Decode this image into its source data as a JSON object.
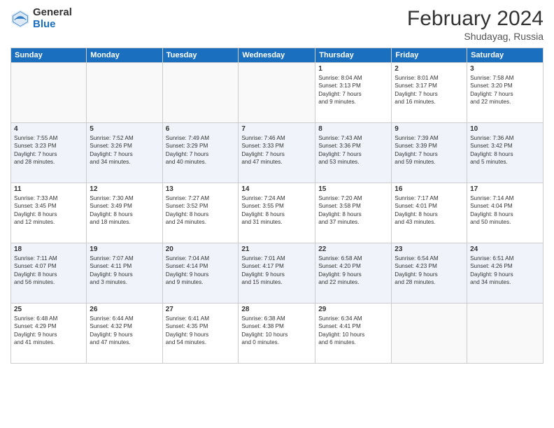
{
  "header": {
    "logo_general": "General",
    "logo_blue": "Blue",
    "title": "February 2024",
    "location": "Shudayag, Russia"
  },
  "days_of_week": [
    "Sunday",
    "Monday",
    "Tuesday",
    "Wednesday",
    "Thursday",
    "Friday",
    "Saturday"
  ],
  "weeks": [
    [
      {
        "day": "",
        "info": ""
      },
      {
        "day": "",
        "info": ""
      },
      {
        "day": "",
        "info": ""
      },
      {
        "day": "",
        "info": ""
      },
      {
        "day": "1",
        "info": "Sunrise: 8:04 AM\nSunset: 3:13 PM\nDaylight: 7 hours\nand 9 minutes."
      },
      {
        "day": "2",
        "info": "Sunrise: 8:01 AM\nSunset: 3:17 PM\nDaylight: 7 hours\nand 16 minutes."
      },
      {
        "day": "3",
        "info": "Sunrise: 7:58 AM\nSunset: 3:20 PM\nDaylight: 7 hours\nand 22 minutes."
      }
    ],
    [
      {
        "day": "4",
        "info": "Sunrise: 7:55 AM\nSunset: 3:23 PM\nDaylight: 7 hours\nand 28 minutes."
      },
      {
        "day": "5",
        "info": "Sunrise: 7:52 AM\nSunset: 3:26 PM\nDaylight: 7 hours\nand 34 minutes."
      },
      {
        "day": "6",
        "info": "Sunrise: 7:49 AM\nSunset: 3:29 PM\nDaylight: 7 hours\nand 40 minutes."
      },
      {
        "day": "7",
        "info": "Sunrise: 7:46 AM\nSunset: 3:33 PM\nDaylight: 7 hours\nand 47 minutes."
      },
      {
        "day": "8",
        "info": "Sunrise: 7:43 AM\nSunset: 3:36 PM\nDaylight: 7 hours\nand 53 minutes."
      },
      {
        "day": "9",
        "info": "Sunrise: 7:39 AM\nSunset: 3:39 PM\nDaylight: 7 hours\nand 59 minutes."
      },
      {
        "day": "10",
        "info": "Sunrise: 7:36 AM\nSunset: 3:42 PM\nDaylight: 8 hours\nand 5 minutes."
      }
    ],
    [
      {
        "day": "11",
        "info": "Sunrise: 7:33 AM\nSunset: 3:45 PM\nDaylight: 8 hours\nand 12 minutes."
      },
      {
        "day": "12",
        "info": "Sunrise: 7:30 AM\nSunset: 3:49 PM\nDaylight: 8 hours\nand 18 minutes."
      },
      {
        "day": "13",
        "info": "Sunrise: 7:27 AM\nSunset: 3:52 PM\nDaylight: 8 hours\nand 24 minutes."
      },
      {
        "day": "14",
        "info": "Sunrise: 7:24 AM\nSunset: 3:55 PM\nDaylight: 8 hours\nand 31 minutes."
      },
      {
        "day": "15",
        "info": "Sunrise: 7:20 AM\nSunset: 3:58 PM\nDaylight: 8 hours\nand 37 minutes."
      },
      {
        "day": "16",
        "info": "Sunrise: 7:17 AM\nSunset: 4:01 PM\nDaylight: 8 hours\nand 43 minutes."
      },
      {
        "day": "17",
        "info": "Sunrise: 7:14 AM\nSunset: 4:04 PM\nDaylight: 8 hours\nand 50 minutes."
      }
    ],
    [
      {
        "day": "18",
        "info": "Sunrise: 7:11 AM\nSunset: 4:07 PM\nDaylight: 8 hours\nand 56 minutes."
      },
      {
        "day": "19",
        "info": "Sunrise: 7:07 AM\nSunset: 4:11 PM\nDaylight: 9 hours\nand 3 minutes."
      },
      {
        "day": "20",
        "info": "Sunrise: 7:04 AM\nSunset: 4:14 PM\nDaylight: 9 hours\nand 9 minutes."
      },
      {
        "day": "21",
        "info": "Sunrise: 7:01 AM\nSunset: 4:17 PM\nDaylight: 9 hours\nand 15 minutes."
      },
      {
        "day": "22",
        "info": "Sunrise: 6:58 AM\nSunset: 4:20 PM\nDaylight: 9 hours\nand 22 minutes."
      },
      {
        "day": "23",
        "info": "Sunrise: 6:54 AM\nSunset: 4:23 PM\nDaylight: 9 hours\nand 28 minutes."
      },
      {
        "day": "24",
        "info": "Sunrise: 6:51 AM\nSunset: 4:26 PM\nDaylight: 9 hours\nand 34 minutes."
      }
    ],
    [
      {
        "day": "25",
        "info": "Sunrise: 6:48 AM\nSunset: 4:29 PM\nDaylight: 9 hours\nand 41 minutes."
      },
      {
        "day": "26",
        "info": "Sunrise: 6:44 AM\nSunset: 4:32 PM\nDaylight: 9 hours\nand 47 minutes."
      },
      {
        "day": "27",
        "info": "Sunrise: 6:41 AM\nSunset: 4:35 PM\nDaylight: 9 hours\nand 54 minutes."
      },
      {
        "day": "28",
        "info": "Sunrise: 6:38 AM\nSunset: 4:38 PM\nDaylight: 10 hours\nand 0 minutes."
      },
      {
        "day": "29",
        "info": "Sunrise: 6:34 AM\nSunset: 4:41 PM\nDaylight: 10 hours\nand 6 minutes."
      },
      {
        "day": "",
        "info": ""
      },
      {
        "day": "",
        "info": ""
      }
    ]
  ]
}
